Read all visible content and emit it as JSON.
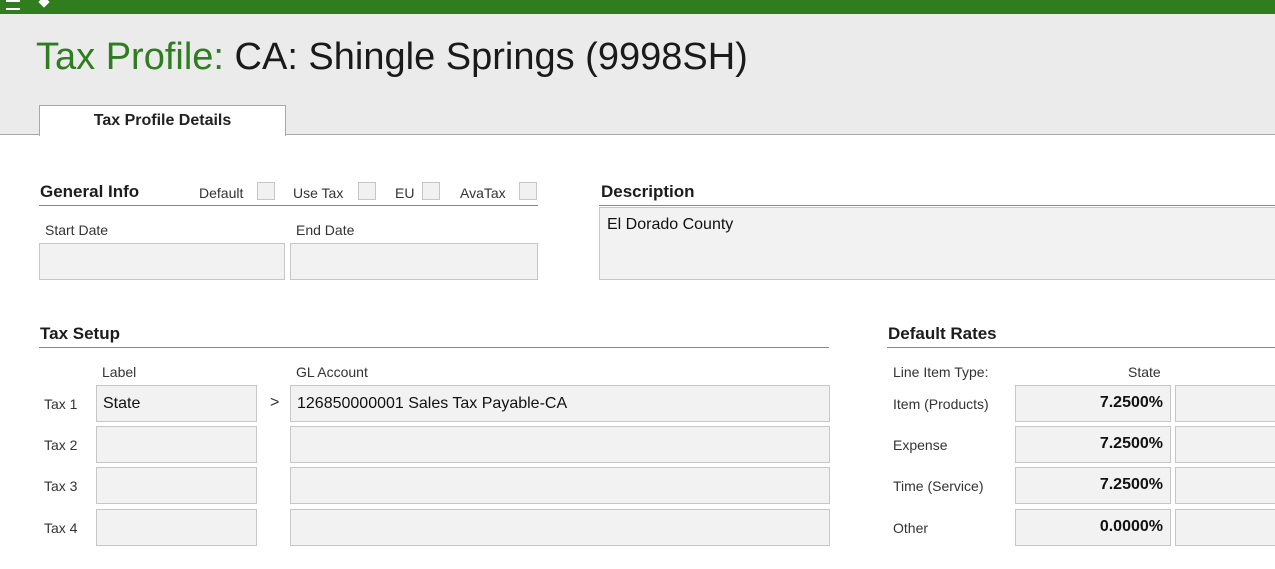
{
  "header": {
    "title_prefix": "Tax Profile:",
    "title_name": "CA: Shingle Springs  (9998SH)"
  },
  "tabs": [
    {
      "label": "Tax Profile Details"
    }
  ],
  "general_info": {
    "title": "General Info",
    "flags": [
      {
        "label": "Default",
        "checked": false
      },
      {
        "label": "Use Tax",
        "checked": false
      },
      {
        "label": "EU",
        "checked": false
      },
      {
        "label": "AvaTax",
        "checked": false
      }
    ],
    "start_date_label": "Start Date",
    "start_date_value": "",
    "end_date_label": "End Date",
    "end_date_value": ""
  },
  "description": {
    "title": "Description",
    "value": "El Dorado County"
  },
  "tax_setup": {
    "title": "Tax Setup",
    "label_header": "Label",
    "gl_header": "GL Account",
    "arrow": ">",
    "rows": [
      {
        "name": "Tax 1",
        "label": "State",
        "gl_account": "126850000001 Sales Tax Payable-CA"
      },
      {
        "name": "Tax 2",
        "label": "",
        "gl_account": ""
      },
      {
        "name": "Tax 3",
        "label": "",
        "gl_account": ""
      },
      {
        "name": "Tax 4",
        "label": "",
        "gl_account": ""
      }
    ]
  },
  "default_rates": {
    "title": "Default Rates",
    "line_item_header": "Line Item Type:",
    "state_header": "State",
    "rows": [
      {
        "type": "Item (Products)",
        "state": "7.2500%"
      },
      {
        "type": "Expense",
        "state": "7.2500%"
      },
      {
        "type": "Time (Service)",
        "state": "7.2500%"
      },
      {
        "type": "Other",
        "state": "0.0000%"
      }
    ]
  },
  "colors": {
    "brand_green": "#2f7d1f",
    "title_green": "#2e7d1e",
    "field_bg": "#f2f2f2",
    "field_border": "#c6c6c6"
  }
}
